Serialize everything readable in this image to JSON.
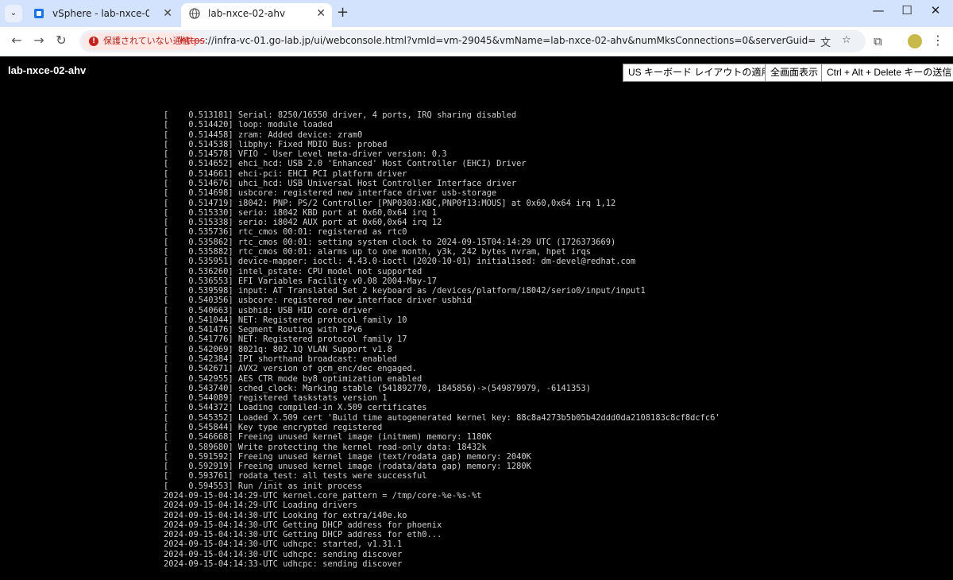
{
  "browser": {
    "tabs": [
      {
        "title": "vSphere - lab-nxce-02-ahv - サ",
        "icon": "vsphere-icon",
        "active": false
      },
      {
        "title": "lab-nxce-02-ahv",
        "icon": "globe-icon",
        "active": true
      }
    ],
    "address": {
      "security_chip": "保護されていない通信",
      "scheme": "https",
      "url_rest": "://infra-vc-01.go-lab.jp/ui/webconsole.html?vmId=vm-29045&vmName=lab-nxce-02-ahv&numMksConnections=0&serverGuid=8ebd5f8b-f647-4f75-8..."
    }
  },
  "console": {
    "vm_name": "lab-nxce-02-ahv",
    "buttons": {
      "us_keyboard": "US キーボード レイアウトの適用",
      "fullscreen": "全画面表示",
      "ctrl_alt_del": "Ctrl + Alt + Delete キーの送信"
    },
    "log_lines": [
      "[    0.513181] Serial: 8250/16550 driver, 4 ports, IRQ sharing disabled",
      "[    0.514420] loop: module loaded",
      "[    0.514458] zram: Added device: zram0",
      "[    0.514538] libphy: Fixed MDIO Bus: probed",
      "[    0.514578] VFIO - User Level meta-driver version: 0.3",
      "[    0.514652] ehci_hcd: USB 2.0 'Enhanced' Host Controller (EHCI) Driver",
      "[    0.514661] ehci-pci: EHCI PCI platform driver",
      "[    0.514676] uhci_hcd: USB Universal Host Controller Interface driver",
      "[    0.514698] usbcore: registered new interface driver usb-storage",
      "[    0.514719] i8042: PNP: PS/2 Controller [PNP0303:KBC,PNP0f13:MOUS] at 0x60,0x64 irq 1,12",
      "[    0.515330] serio: i8042 KBD port at 0x60,0x64 irq 1",
      "[    0.515338] serio: i8042 AUX port at 0x60,0x64 irq 12",
      "[    0.535736] rtc_cmos 00:01: registered as rtc0",
      "[    0.535862] rtc_cmos 00:01: setting system clock to 2024-09-15T04:14:29 UTC (1726373669)",
      "[    0.535882] rtc_cmos 00:01: alarms up to one month, y3k, 242 bytes nvram, hpet irqs",
      "[    0.535951] device-mapper: ioctl: 4.43.0-ioctl (2020-10-01) initialised: dm-devel@redhat.com",
      "[    0.536260] intel_pstate: CPU model not supported",
      "[    0.536553] EFI Variables Facility v0.08 2004-May-17",
      "[    0.539598] input: AT Translated Set 2 keyboard as /devices/platform/i8042/serio0/input/input1",
      "[    0.540356] usbcore: registered new interface driver usbhid",
      "[    0.540663] usbhid: USB HID core driver",
      "[    0.541044] NET: Registered protocol family 10",
      "[    0.541476] Segment Routing with IPv6",
      "[    0.541776] NET: Registered protocol family 17",
      "[    0.542069] 8021q: 802.1Q VLAN Support v1.8",
      "[    0.542384] IPI shorthand broadcast: enabled",
      "[    0.542671] AVX2 version of gcm_enc/dec engaged.",
      "[    0.542955] AES CTR mode by8 optimization enabled",
      "[    0.543740] sched_clock: Marking stable (541892770, 1845856)->(549879979, -6141353)",
      "[    0.544089] registered taskstats version 1",
      "[    0.544372] Loading compiled-in X.509 certificates",
      "[    0.545352] Loaded X.509 cert 'Build time autogenerated kernel key: 88c8a4273b5b05b42ddd0da2108183c8cf8dcfc6'",
      "[    0.545844] Key type encrypted registered",
      "[    0.546668] Freeing unused kernel image (initmem) memory: 1180K",
      "[    0.589680] Write protecting the kernel read-only data: 18432k",
      "[    0.591592] Freeing unused kernel image (text/rodata gap) memory: 2040K",
      "[    0.592919] Freeing unused kernel image (rodata/data gap) memory: 1280K",
      "[    0.593761] rodata_test: all tests were successful",
      "[    0.594553] Run /init as init process",
      "2024-09-15-04:14:29-UTC kernel.core_pattern = /tmp/core-%e-%s-%t",
      "2024-09-15-04:14:29-UTC Loading drivers",
      "2024-09-15-04:14:30-UTC Looking for extra/i40e.ko",
      "2024-09-15-04:14:30-UTC Getting DHCP address for phoenix",
      "2024-09-15-04:14:30-UTC Getting DHCP address for eth0...",
      "2024-09-15-04:14:30-UTC udhcpc: started, v1.31.1",
      "2024-09-15-04:14:30-UTC udhcpc: sending discover",
      "2024-09-15-04:14:33-UTC udhcpc: sending discover"
    ]
  }
}
